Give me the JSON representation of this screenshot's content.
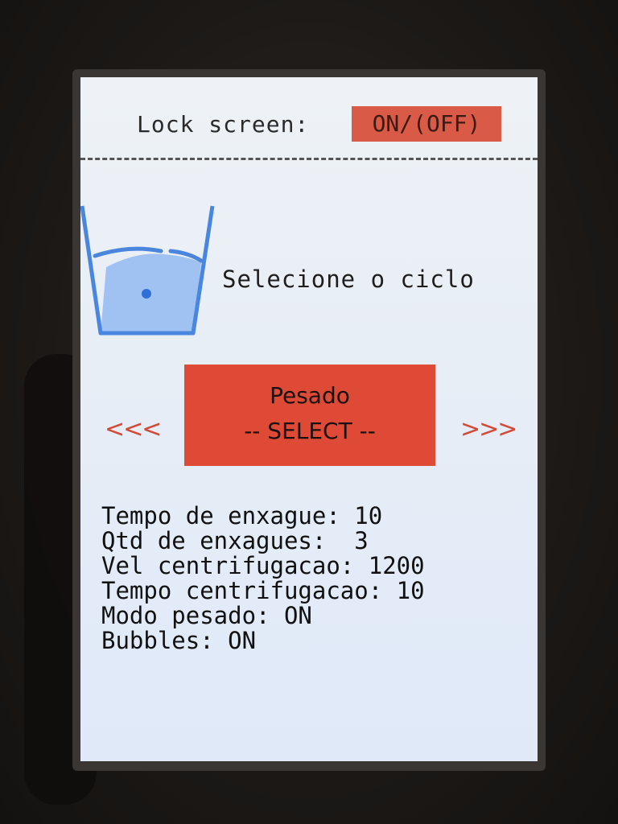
{
  "lock": {
    "label": "Lock screen:",
    "value": "ON/(OFF)"
  },
  "cycle": {
    "prompt": "Selecione o ciclo",
    "selected_name": "Pesado",
    "select_label": "-- SELECT --",
    "prev_label": "<<<",
    "next_label": ">>>"
  },
  "icons": {
    "tub": "washtub-water-icon"
  },
  "params": [
    "Tempo de enxague: 10",
    "Qtd de enxagues:  3",
    "Vel centrifugacao: 1200",
    "Tempo centrifugacao: 10",
    "Modo pesado: ON",
    "Bubbles: ON"
  ],
  "colors": {
    "accent": "#de4a35",
    "toggle": "#d95a46",
    "icon": "#4a8ae0",
    "screen_bg": "#e8eef6"
  }
}
